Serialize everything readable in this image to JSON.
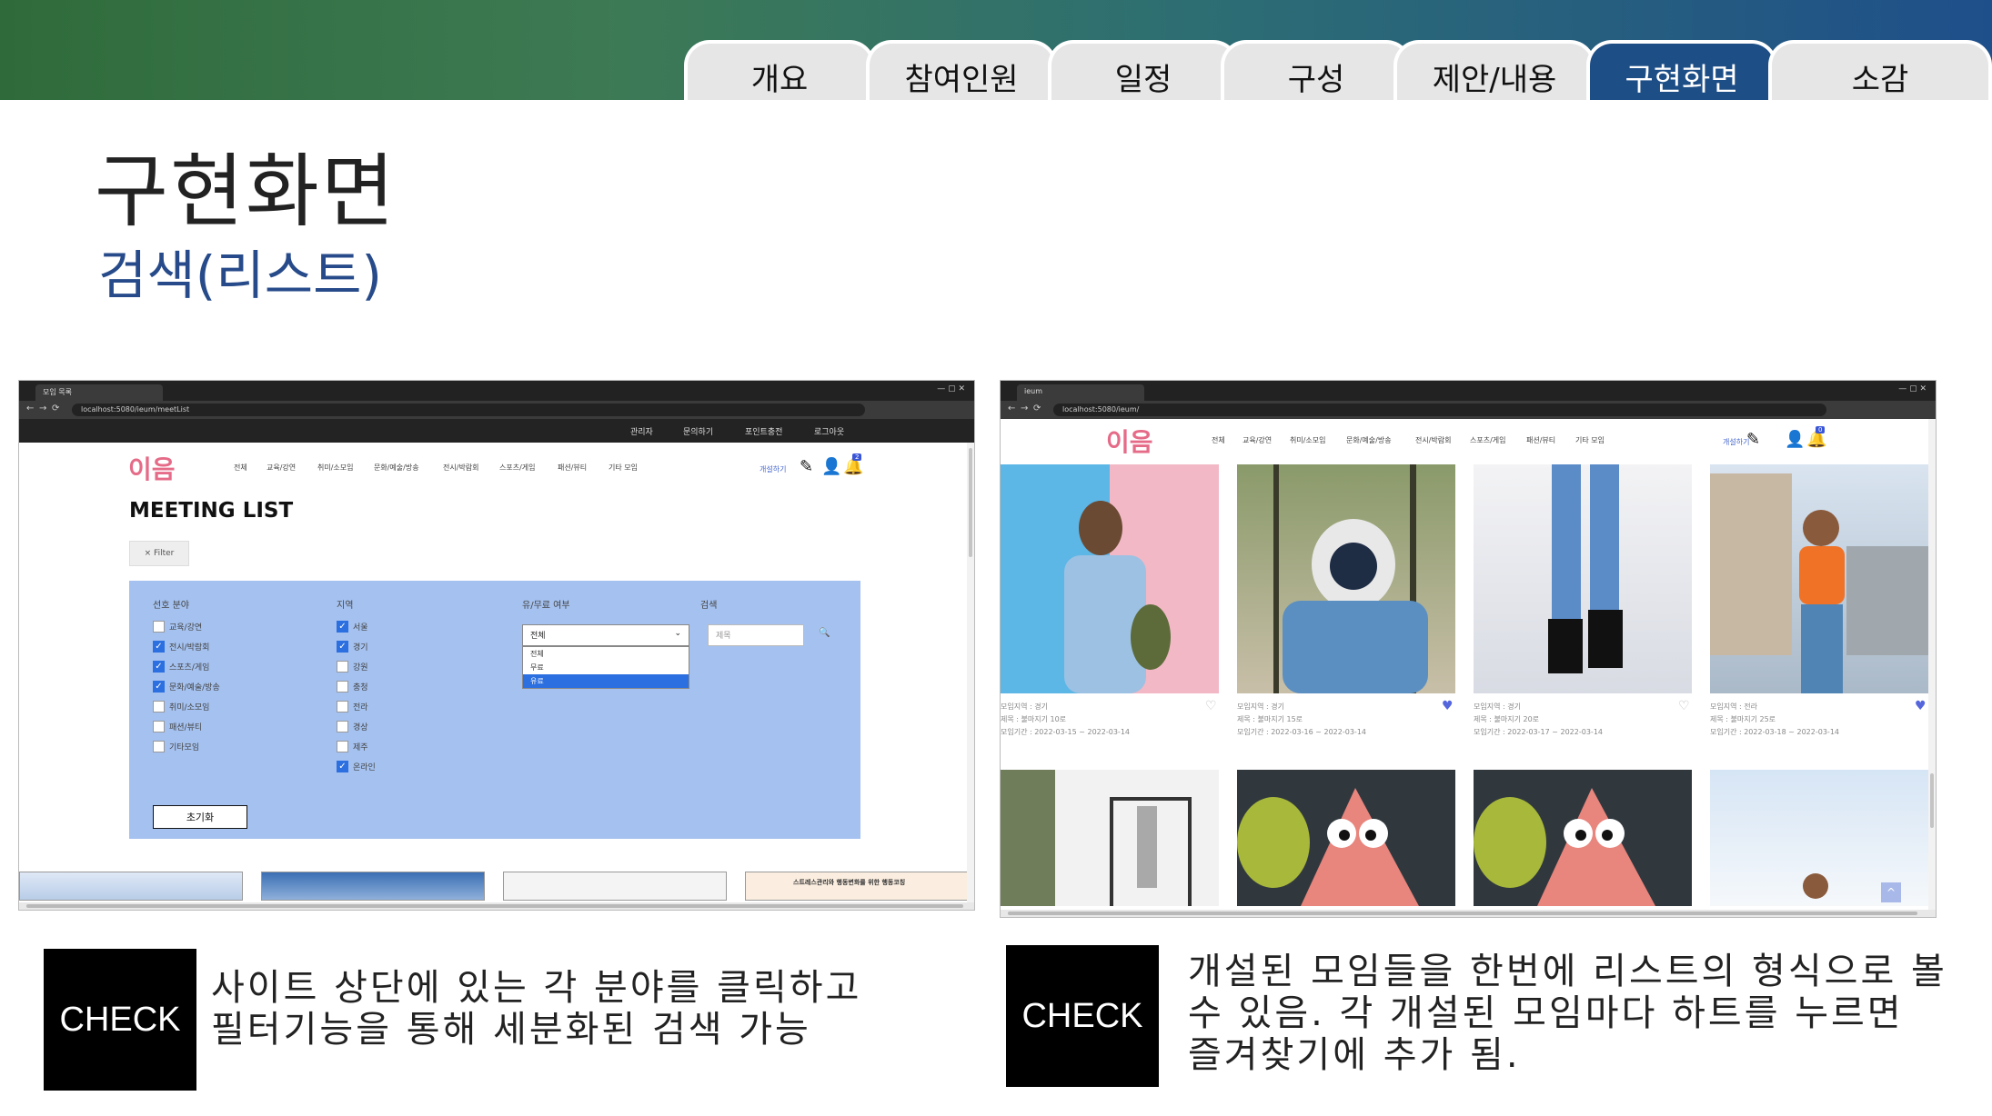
{
  "tabs": [
    "개요",
    "참여인원",
    "일정",
    "구성",
    "제안/내용",
    "구현화면",
    "소감"
  ],
  "active_tab": "구현화면",
  "title": "구현화면",
  "subtitle": "검색(리스트)",
  "shot1": {
    "browser_tab": "모임 목록",
    "url": "localhost:5080/ieum/meetList",
    "top_menu": [
      "관리자",
      "문의하기",
      "포인트충전",
      "로그아웃"
    ],
    "logo": "이음",
    "nav": [
      "전체",
      "교육/강연",
      "취미/소모임",
      "문화/예술/방송",
      "전시/박람회",
      "스포츠/게임",
      "패션/뷰티",
      "기타 모임"
    ],
    "create_label": "개설하기",
    "badge": "2",
    "heading": "MEETING LIST",
    "filter_label": "× Filter",
    "columns": [
      "선호 분야",
      "지역",
      "유/무료 여부",
      "검색"
    ],
    "categories": [
      {
        "label": "교육/강연",
        "checked": false
      },
      {
        "label": "전시/박람회",
        "checked": true
      },
      {
        "label": "스포츠/게임",
        "checked": true
      },
      {
        "label": "문화/예술/방송",
        "checked": true
      },
      {
        "label": "취미/소모임",
        "checked": false
      },
      {
        "label": "패션/뷰티",
        "checked": false
      },
      {
        "label": "기타모임",
        "checked": false
      }
    ],
    "regions": [
      {
        "label": "서울",
        "checked": true
      },
      {
        "label": "경기",
        "checked": true
      },
      {
        "label": "강원",
        "checked": false
      },
      {
        "label": "충청",
        "checked": false
      },
      {
        "label": "전라",
        "checked": false
      },
      {
        "label": "경상",
        "checked": false
      },
      {
        "label": "제주",
        "checked": false
      },
      {
        "label": "온라인",
        "checked": true
      }
    ],
    "fee_selected": "전체",
    "fee_options": [
      "전체",
      "무료",
      "유료"
    ],
    "fee_highlight": "유료",
    "search_placeholder": "제목",
    "reset_label": "초기화",
    "thumb_banner_text": "스트레스관리와 행동변화를 위한 행동코칭"
  },
  "shot2": {
    "browser_tab": "ieum",
    "url": "localhost:5080/ieum/",
    "logo": "이음",
    "nav": [
      "전체",
      "교육/강연",
      "취미/소모임",
      "문화/예술/방송",
      "전시/박람회",
      "스포츠/게임",
      "패션/뷰티",
      "기타 모임"
    ],
    "create_label": "개설하기",
    "badge": "0",
    "cards": [
      {
        "region": "모임지역 : 경기",
        "title": "제목 : 불마지기 10로",
        "period": "모임기간 : 2022-03-15 ~ 2022-03-14",
        "liked": false
      },
      {
        "region": "모임지역 : 경기",
        "title": "제목 : 불마지기 15로",
        "period": "모임기간 : 2022-03-16 ~ 2022-03-14",
        "liked": true
      },
      {
        "region": "모임지역 : 경기",
        "title": "제목 : 불마지기 20로",
        "period": "모임기간 : 2022-03-17 ~ 2022-03-14",
        "liked": false
      },
      {
        "region": "모임지역 : 전라",
        "title": "제목 : 불마지기 25로",
        "period": "모임기간 : 2022-03-18 ~ 2022-03-14",
        "liked": true
      }
    ],
    "scroll_top_icon": "^"
  },
  "check_label": "CHECK",
  "check1_text": [
    "사이트 상단에 있는 각 분야를 클릭하고",
    "필터기능을 통해 세분화된 검색 가능"
  ],
  "check2_text": [
    "개설된 모임들을 한번에 리스트의 형식으로 볼",
    "수 있음. 각 개설된 모임마다 하트를 누르면",
    "즐겨찾기에 추가 됨."
  ],
  "colors": {
    "accent": "#1e4e86",
    "header_start": "#2f6b3a",
    "panel": "#a4c1ef",
    "heart": "#5566dd"
  }
}
